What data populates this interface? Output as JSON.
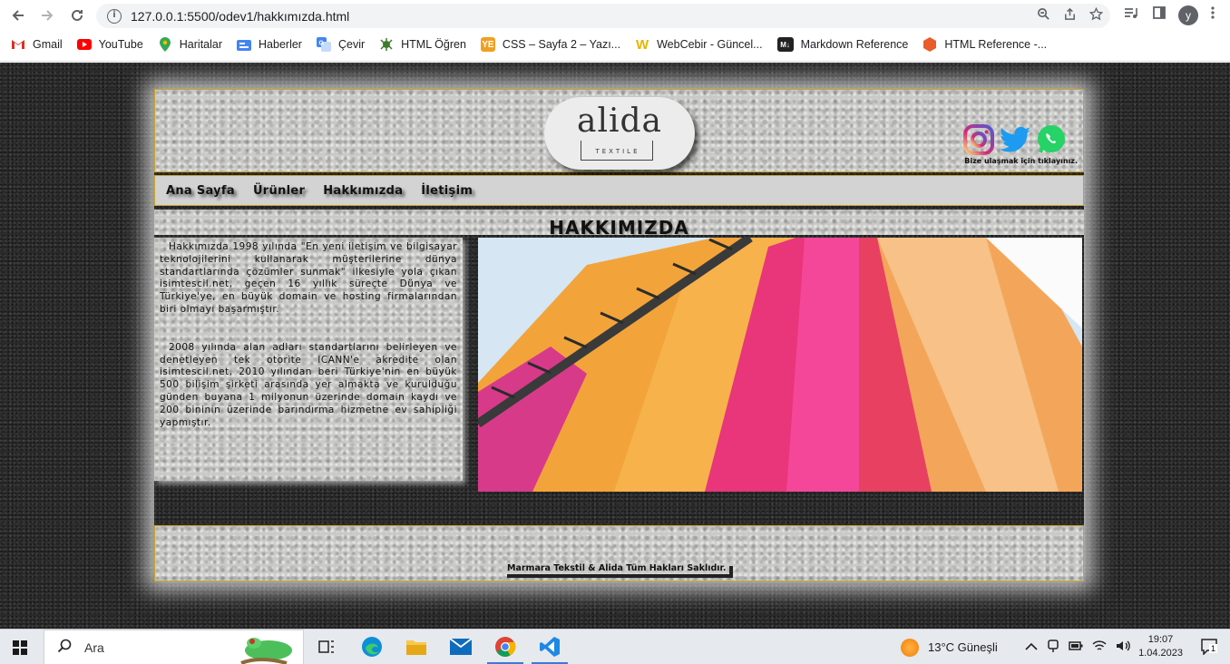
{
  "browser": {
    "url": "127.0.0.1:5500/odev1/hakkımızda.html",
    "profile_initial": "y",
    "bookmarks": [
      {
        "label": "Gmail",
        "icon": "gmail-icon"
      },
      {
        "label": "YouTube",
        "icon": "youtube-icon"
      },
      {
        "label": "Haritalar",
        "icon": "maps-icon"
      },
      {
        "label": "Haberler",
        "icon": "news-icon"
      },
      {
        "label": "Çevir",
        "icon": "translate-icon"
      },
      {
        "label": "HTML Öğren",
        "icon": "html-ogren-icon"
      },
      {
        "label": "CSS – Sayfa 2 – Yazı...",
        "icon": "css-icon"
      },
      {
        "label": "WebCebir - Güncel...",
        "icon": "webcebir-icon"
      },
      {
        "label": "Markdown Reference",
        "icon": "markdown-icon"
      },
      {
        "label": "HTML Reference -...",
        "icon": "html-reference-icon"
      }
    ]
  },
  "site": {
    "logo": {
      "brand": "alida",
      "sub": "TEXTILE"
    },
    "social_text": "Bize ulaşmak için tıklayınız.",
    "nav": [
      "Ana Sayfa",
      "Ürünler",
      "Hakkımızda",
      "İletişim"
    ],
    "page_title": "HAKKIMIZDA",
    "paragraphs": [
      "Hakkımızda 1998 yılında \"En yeni iletişim ve bilgisayar teknolojilerini kullanarak müşterilerine dünya standartlarında çözümler sunmak\" ilkesiyle yola çıkan isimtescil.net, geçen 16 yıllık süreçte Dünya ve Türkiye'ye, en büyük domain ve hosting firmalarından biri olmayı başarmıştır.",
      "2008 yılında alan adları standartlarını belirleyen ve denetleyen tek otorite ICANN'e akredite olan isimtescil.net, 2010 yılından beri Türkiye'nin en büyük 500 bilişim şirketi arasında yer almakta ve kurulduğu günden buyana 1 milyonun üzerinde domain kaydı ve 200 bininin üzerinde barındırma hizmetne ev sahipliği yapmıştır."
    ],
    "copyright": "Marmara Tekstil & Alida Tüm Hakları Saklıdır."
  },
  "taskbar": {
    "search_label": "Ara",
    "weather": "13°C  Güneşli",
    "time": "19:07",
    "date": "1.04.2023",
    "notification_count": "1"
  },
  "colors": {
    "accent_border": "#c9a227",
    "navbar_bg": "#d3d3d3",
    "page_bg": "#2b2b2b"
  }
}
